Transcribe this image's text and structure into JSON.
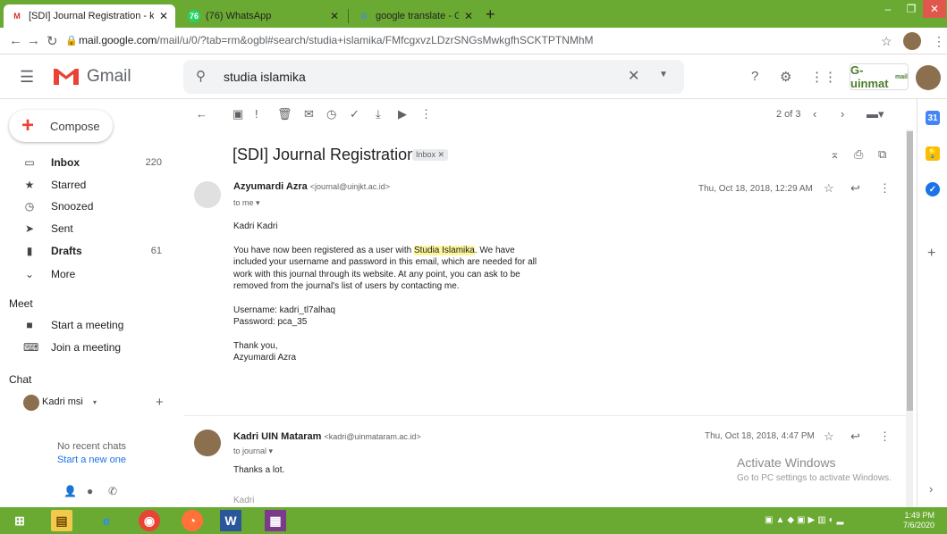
{
  "browser": {
    "tabs": [
      {
        "label": "[SDI] Journal Registration - kadri",
        "active": true,
        "favicon": "M"
      },
      {
        "label": "(76) WhatsApp",
        "active": false,
        "favicon": "76"
      },
      {
        "label": "google translate - Google Search",
        "active": false,
        "favicon": "G"
      }
    ],
    "url_host": "mail.google.com",
    "url_path": "/mail/u/0/?tab=rm&ogbl#search/studia+islamika/FMfcgxvzLDzrSNGsMwkgfhSCKTPTNMhM"
  },
  "gmail": {
    "title": "Gmail",
    "search_query": "studia islamika",
    "brand_logo": "G-uinmat",
    "brand_logo_sub": "mail"
  },
  "sidebar": {
    "compose_label": "Compose",
    "items": [
      {
        "label": "Inbox",
        "count": "220",
        "bold": true,
        "icon": "inbox-icon"
      },
      {
        "label": "Starred",
        "count": "",
        "bold": false,
        "icon": "star-icon"
      },
      {
        "label": "Snoozed",
        "count": "",
        "bold": false,
        "icon": "clock-icon"
      },
      {
        "label": "Sent",
        "count": "",
        "bold": false,
        "icon": "send-icon"
      },
      {
        "label": "Drafts",
        "count": "61",
        "bold": true,
        "icon": "draft-icon"
      },
      {
        "label": "More",
        "count": "",
        "bold": false,
        "icon": "chevron-down-icon"
      }
    ],
    "meet_heading": "Meet",
    "meet_items": [
      {
        "label": "Start a meeting",
        "icon": "video-icon"
      },
      {
        "label": "Join a meeting",
        "icon": "keyboard-icon"
      }
    ],
    "chat_heading": "Chat",
    "chat_user": "Kadri msi",
    "no_chats": "No recent chats",
    "start_new": "Start a new one"
  },
  "toolbar": {
    "pager": "2 of 3"
  },
  "thread": {
    "subject": "[SDI] Journal Registration",
    "label_badge": "Inbox",
    "messages": [
      {
        "sender_name": "Azyumardi Azra",
        "sender_email": "<journal@uinjkt.ac.id>",
        "to": "to me",
        "date": "Thu, Oct 18, 2018, 12:29 AM",
        "greeting": "Kadri Kadri",
        "para_1": "You have now been registered as a user with",
        "para_highlight": "Studia Islamika",
        "para_1b": ". We have",
        "para_2": "included your username and password in this email, which are needed for all",
        "para_3": "work with this journal through its website. At any point, you can ask to be",
        "para_4": "removed from the journal's list of users by contacting me.",
        "username_line": "Username: kadri_tl7alhaq",
        "password_line": "Password: pca_35",
        "closing": "Thank you,",
        "signature": "Azyumardi Azra"
      },
      {
        "sender_name": "Kadri UIN Mataram",
        "sender_email": "<kadri@uinmataram.ac.id>",
        "to": "to journal",
        "date": "Thu, Oct 18, 2018, 4:47 PM",
        "body": "Thanks a lot.",
        "cut_text": "Kadri"
      }
    ]
  },
  "watermark": {
    "line1": "Activate Windows",
    "line2": "Go to PC settings to activate Windows."
  },
  "taskbar": {
    "time": "1:49 PM",
    "date": "7/6/2020"
  }
}
